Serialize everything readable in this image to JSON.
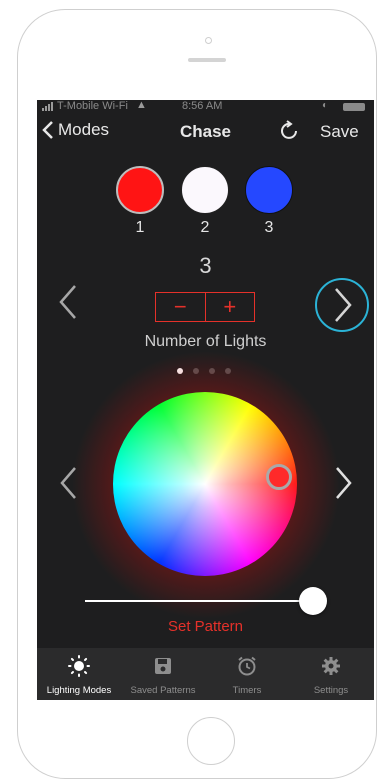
{
  "status": {
    "carrier": "T-Mobile Wi-Fi",
    "time": "8:56 AM"
  },
  "nav": {
    "back_label": "Modes",
    "title": "Chase",
    "save_label": "Save"
  },
  "swatches": [
    {
      "label": "1",
      "color": "#ff1414"
    },
    {
      "label": "2",
      "color": "#fbf8fd"
    },
    {
      "label": "3",
      "color": "#2548ff"
    }
  ],
  "lights": {
    "count": "3",
    "minus": "−",
    "plus": "+",
    "label": "Number of Lights"
  },
  "pager": {
    "page_count": 4,
    "active_index": 0
  },
  "color_wheel": {
    "selected_color": "#ff2a2a"
  },
  "brightness": {
    "value": 1.0
  },
  "set_pattern_label": "Set Pattern",
  "tabs": [
    {
      "label": "Lighting Modes",
      "icon": "sun-icon",
      "active": true
    },
    {
      "label": "Saved Patterns",
      "icon": "floppy-disk-icon",
      "active": false
    },
    {
      "label": "Timers",
      "icon": "alarm-clock-icon",
      "active": false
    },
    {
      "label": "Settings",
      "icon": "gear-icon",
      "active": false
    }
  ],
  "colors": {
    "accent": "#e5312a",
    "highlight_ring": "#2bb3d6",
    "background": "#1e1e1f",
    "tabbar": "#2b2b2c"
  }
}
